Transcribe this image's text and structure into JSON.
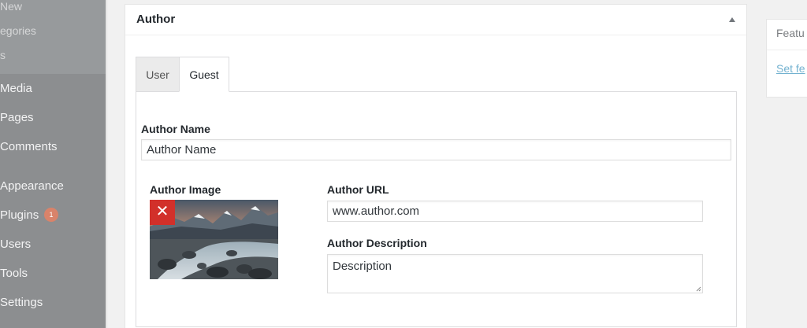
{
  "sidebar": {
    "submenu": [
      "New",
      "egories",
      "s"
    ],
    "items": [
      {
        "label": "Media"
      },
      {
        "label": "Pages"
      },
      {
        "label": "Comments"
      },
      {
        "label": "Appearance"
      },
      {
        "label": "Plugins",
        "badge": "1"
      },
      {
        "label": "Users"
      },
      {
        "label": "Tools"
      },
      {
        "label": "Settings"
      }
    ]
  },
  "author_box": {
    "title": "Author",
    "tabs": [
      {
        "label": "User",
        "active": false
      },
      {
        "label": "Guest",
        "active": true
      }
    ],
    "name": {
      "label": "Author Name",
      "value": "Author Name"
    },
    "image": {
      "label": "Author Image",
      "remove_icon": "close-icon"
    },
    "url": {
      "label": "Author URL",
      "value": "www.author.com"
    },
    "description": {
      "label": "Author Description",
      "value": "Description"
    }
  },
  "featured_image": {
    "title": "Featu",
    "link": "Set fe"
  },
  "colors": {
    "sidebar": "#8c8e90",
    "link": "#0073aa",
    "remove_button": "#d2302a"
  }
}
